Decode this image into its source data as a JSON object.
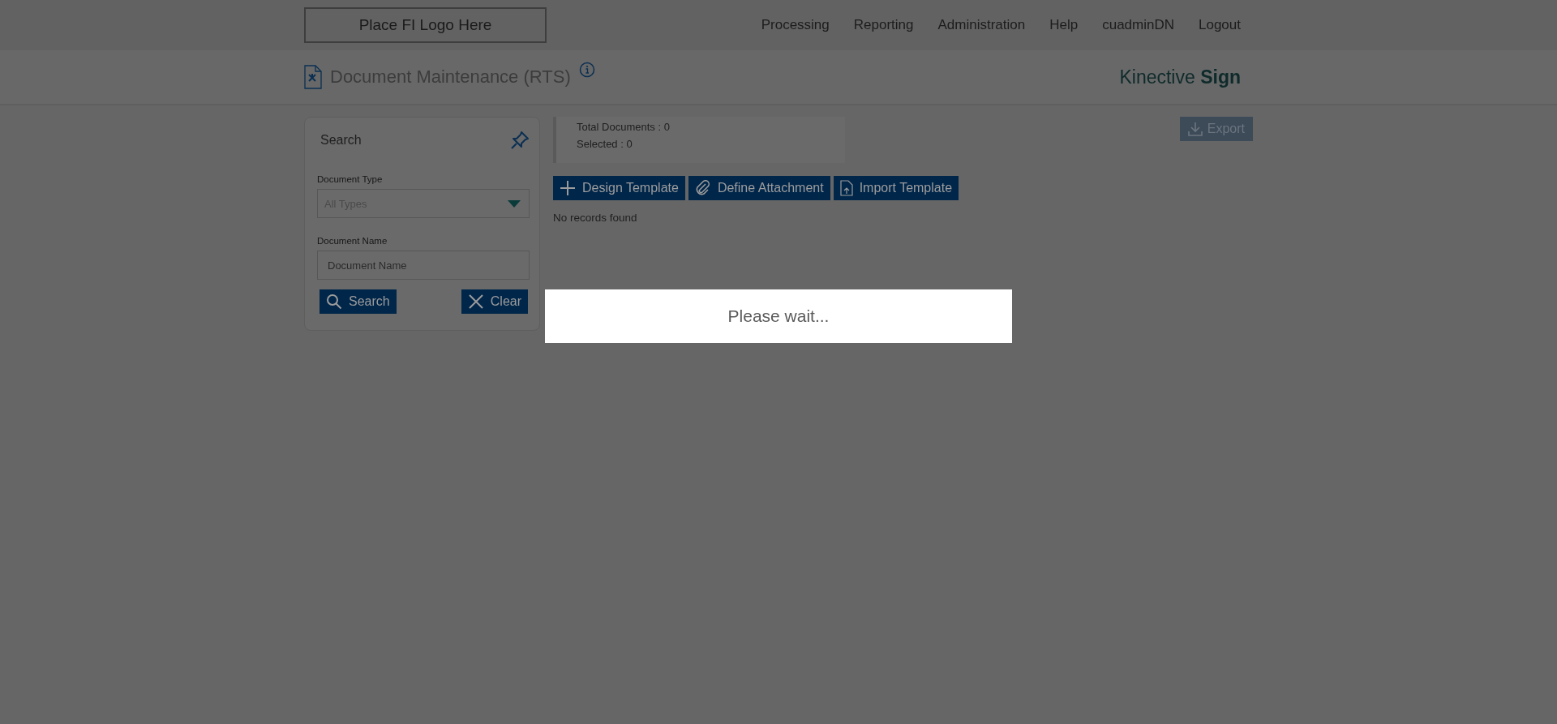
{
  "logo": {
    "text": "Place FI Logo Here"
  },
  "nav": [
    {
      "label": "Processing"
    },
    {
      "label": "Reporting"
    },
    {
      "label": "Administration"
    },
    {
      "label": "Help"
    },
    {
      "label": "cuadminDN"
    },
    {
      "label": "Logout"
    }
  ],
  "page_header": {
    "title": "Document Maintenance (RTS)",
    "brand": "Kinective **Sign**"
  },
  "search_panel": {
    "title": "Search",
    "fields": [
      {
        "kind": "select",
        "label": "Document Type",
        "value": "All Types"
      },
      {
        "kind": "text",
        "label": "Document Name",
        "placeholder": "Document Name"
      }
    ],
    "buttons": [
      {
        "kind": "search",
        "label": "Search"
      },
      {
        "kind": "clear",
        "label": "Clear"
      }
    ]
  },
  "summary": [
    "Total Documents : 0",
    "Selected : 0"
  ],
  "actions": [
    {
      "kind": "design",
      "label": "Design Template"
    },
    {
      "kind": "attach",
      "label": "Define Attachment"
    },
    {
      "kind": "import",
      "label": "Import Template"
    }
  ],
  "empty_message": "No records found",
  "export": {
    "label": "Export",
    "disabled": true
  },
  "loading": {
    "message": "Please wait..."
  }
}
